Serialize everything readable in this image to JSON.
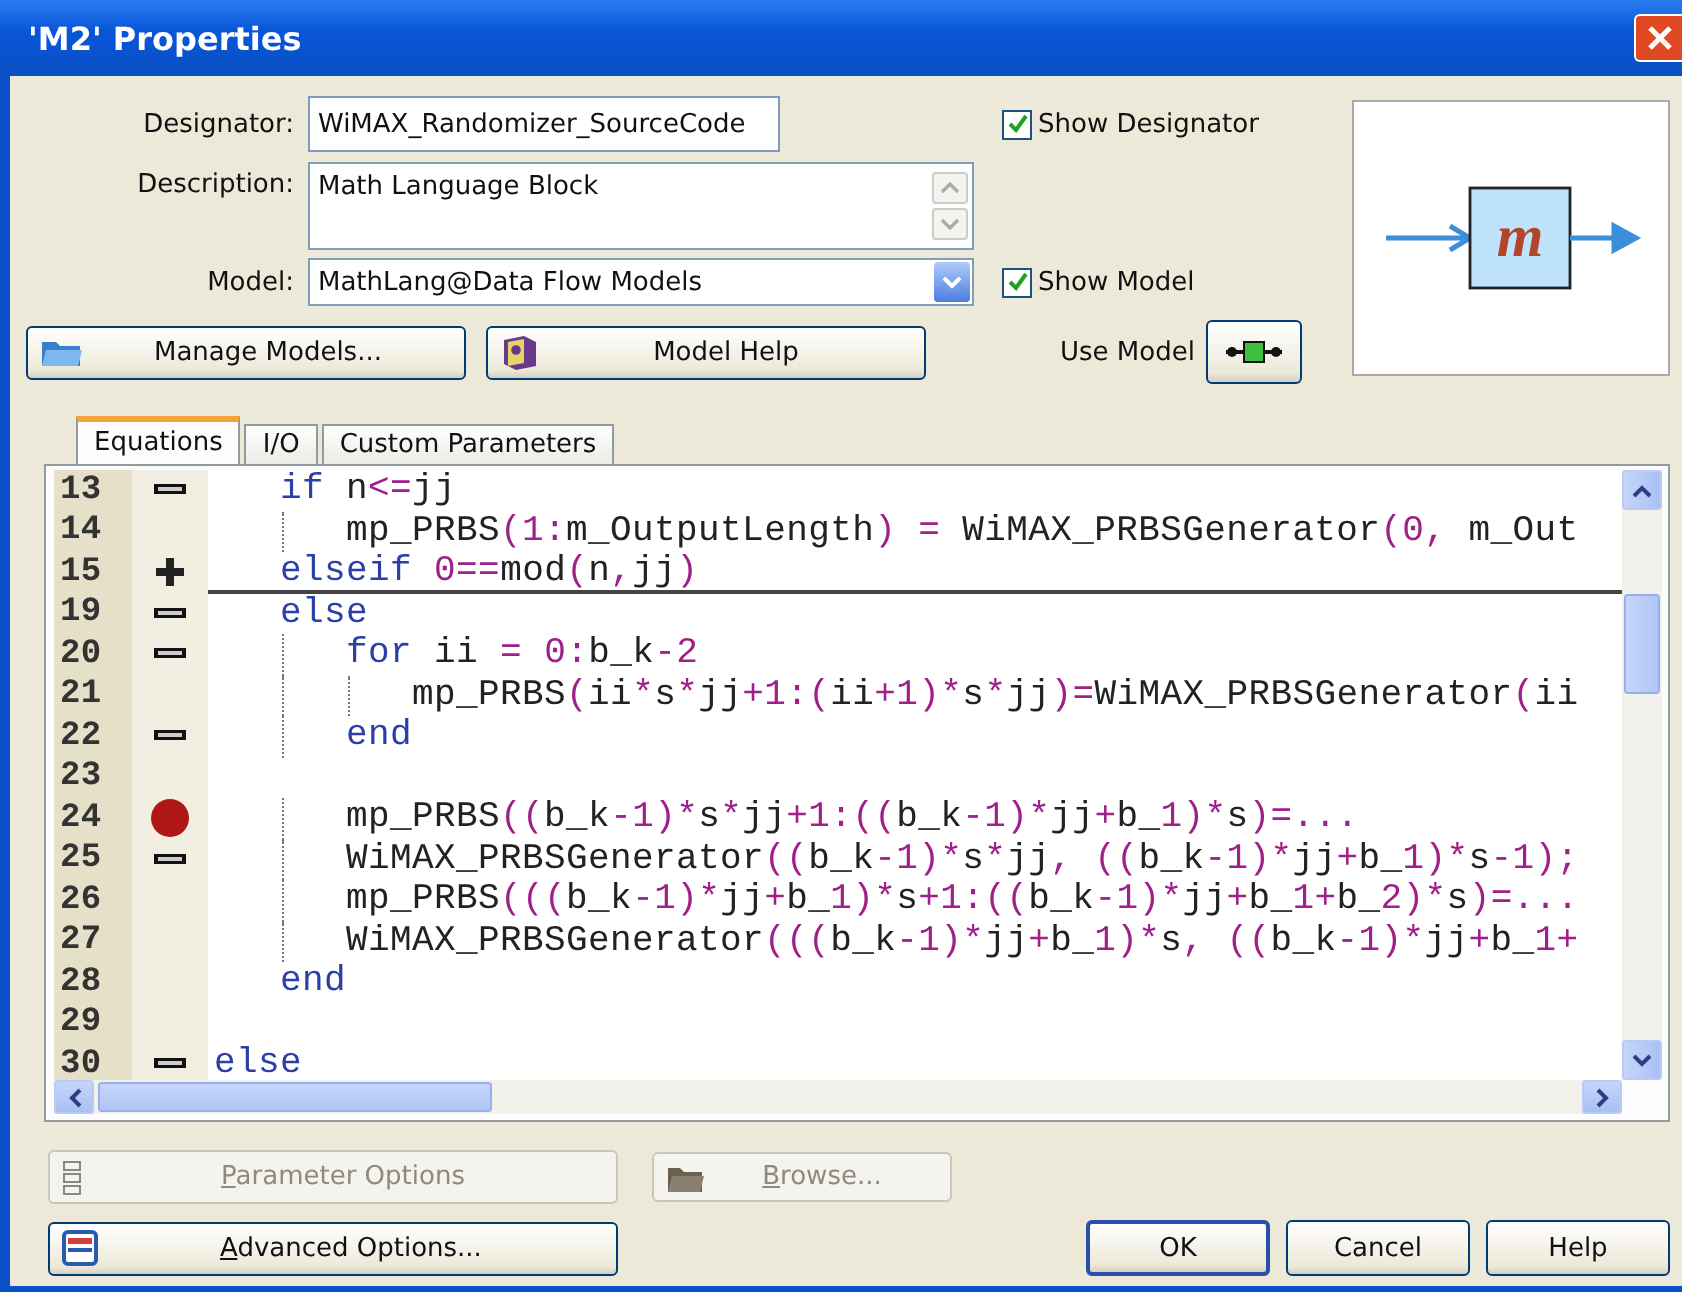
{
  "window": {
    "title": "'M2' Properties"
  },
  "designator": {
    "label": "Designator:",
    "value": "WiMAX_Randomizer_SourceCode"
  },
  "description": {
    "label": "Description:",
    "value": "Math Language Block"
  },
  "model": {
    "label": "Model:",
    "value": "MathLang@Data Flow Models"
  },
  "show_designator": {
    "label": "Show Designator",
    "checked": true
  },
  "show_model": {
    "label": "Show Model",
    "checked": true
  },
  "manage_models": {
    "label": "Manage Models..."
  },
  "model_help": {
    "label": "Model Help"
  },
  "use_model": {
    "label": "Use Model"
  },
  "preview": {
    "symbol": "m"
  },
  "tabs": [
    {
      "label": "Equations",
      "selected": true
    },
    {
      "label": "I/O",
      "selected": false
    },
    {
      "label": "Custom Parameters",
      "selected": false
    }
  ],
  "editor": {
    "lines": [
      {
        "number": "13",
        "kind": "minus",
        "code": [
          {
            "kind": "keyword",
            "text": "   if"
          },
          {
            "kind": "plain",
            "text": " n<=jj"
          }
        ]
      },
      {
        "number": "14",
        "kind": "none",
        "code": [
          {
            "kind": "plain",
            "text": "      mp_PRBS(1:m_OutputLength) = WiMAX_PRBSGenerator(0, m_Out"
          }
        ]
      },
      {
        "number": "15",
        "kind": "plus",
        "code": [
          {
            "kind": "keyword",
            "text": "   elseif"
          },
          {
            "kind": "plain",
            "text": " 0==mod(n,jj)"
          }
        ]
      },
      {
        "number": "19",
        "kind": "minus",
        "code": [
          {
            "kind": "keyword",
            "text": "   else"
          }
        ]
      },
      {
        "number": "20",
        "kind": "minus",
        "code": [
          {
            "kind": "keyword",
            "text": "      for"
          },
          {
            "kind": "plain",
            "text": " ii = 0:b_k-2"
          }
        ]
      },
      {
        "number": "21",
        "kind": "none",
        "code": [
          {
            "kind": "plain",
            "text": "         mp_PRBS(ii*s*jj+1:(ii+1)*s*jj)=WiMAX_PRBSGenerator(ii"
          }
        ]
      },
      {
        "number": "22",
        "kind": "minus",
        "code": [
          {
            "kind": "keyword",
            "text": "      end"
          }
        ]
      },
      {
        "number": "23",
        "kind": "none"
      },
      {
        "number": "24",
        "kind": "breakpoint",
        "code": [
          {
            "kind": "plain",
            "text": "      mp_PRBS((b_k-1)*s*jj+1:((b_k-1)*jj+b_1)*s)=..."
          }
        ]
      },
      {
        "number": "25",
        "kind": "minus",
        "code": [
          {
            "kind": "plain",
            "text": "      WiMAX_PRBSGenerator((b_k-1)*s*jj, ((b_k-1)*jj+b_1)*s-1);"
          }
        ]
      },
      {
        "number": "26",
        "kind": "none",
        "code": [
          {
            "kind": "plain",
            "text": "      mp_PRBS(((b_k-1)*jj+b_1)*s+1:((b_k-1)*jj+b_1+b_2)*s)=..."
          }
        ]
      },
      {
        "number": "27",
        "kind": "none",
        "code": [
          {
            "kind": "plain",
            "text": "      WiMAX_PRBSGenerator(((b_k-1)*jj+b_1)*s, ((b_k-1)*jj+b_1+"
          }
        ]
      },
      {
        "number": "28",
        "kind": "none",
        "code": [
          {
            "kind": "keyword",
            "text": "   end"
          }
        ]
      },
      {
        "number": "29",
        "kind": "none"
      },
      {
        "number": "30",
        "kind": "minus",
        "code": [
          {
            "kind": "keyword",
            "text": "else"
          }
        ]
      }
    ]
  },
  "parameter_options": {
    "label": "Parameter Options",
    "disabled": true,
    "underline_first": true
  },
  "browse": {
    "label": "Browse...",
    "disabled": true,
    "underline_first": true
  },
  "advanced_options": {
    "label": "Advanced Options...",
    "disabled": false,
    "underline_first": true
  },
  "dialog_buttons": [
    {
      "label": "OK",
      "default": true
    },
    {
      "label": "Cancel",
      "default": false
    },
    {
      "label": "Help",
      "default": false
    }
  ]
}
